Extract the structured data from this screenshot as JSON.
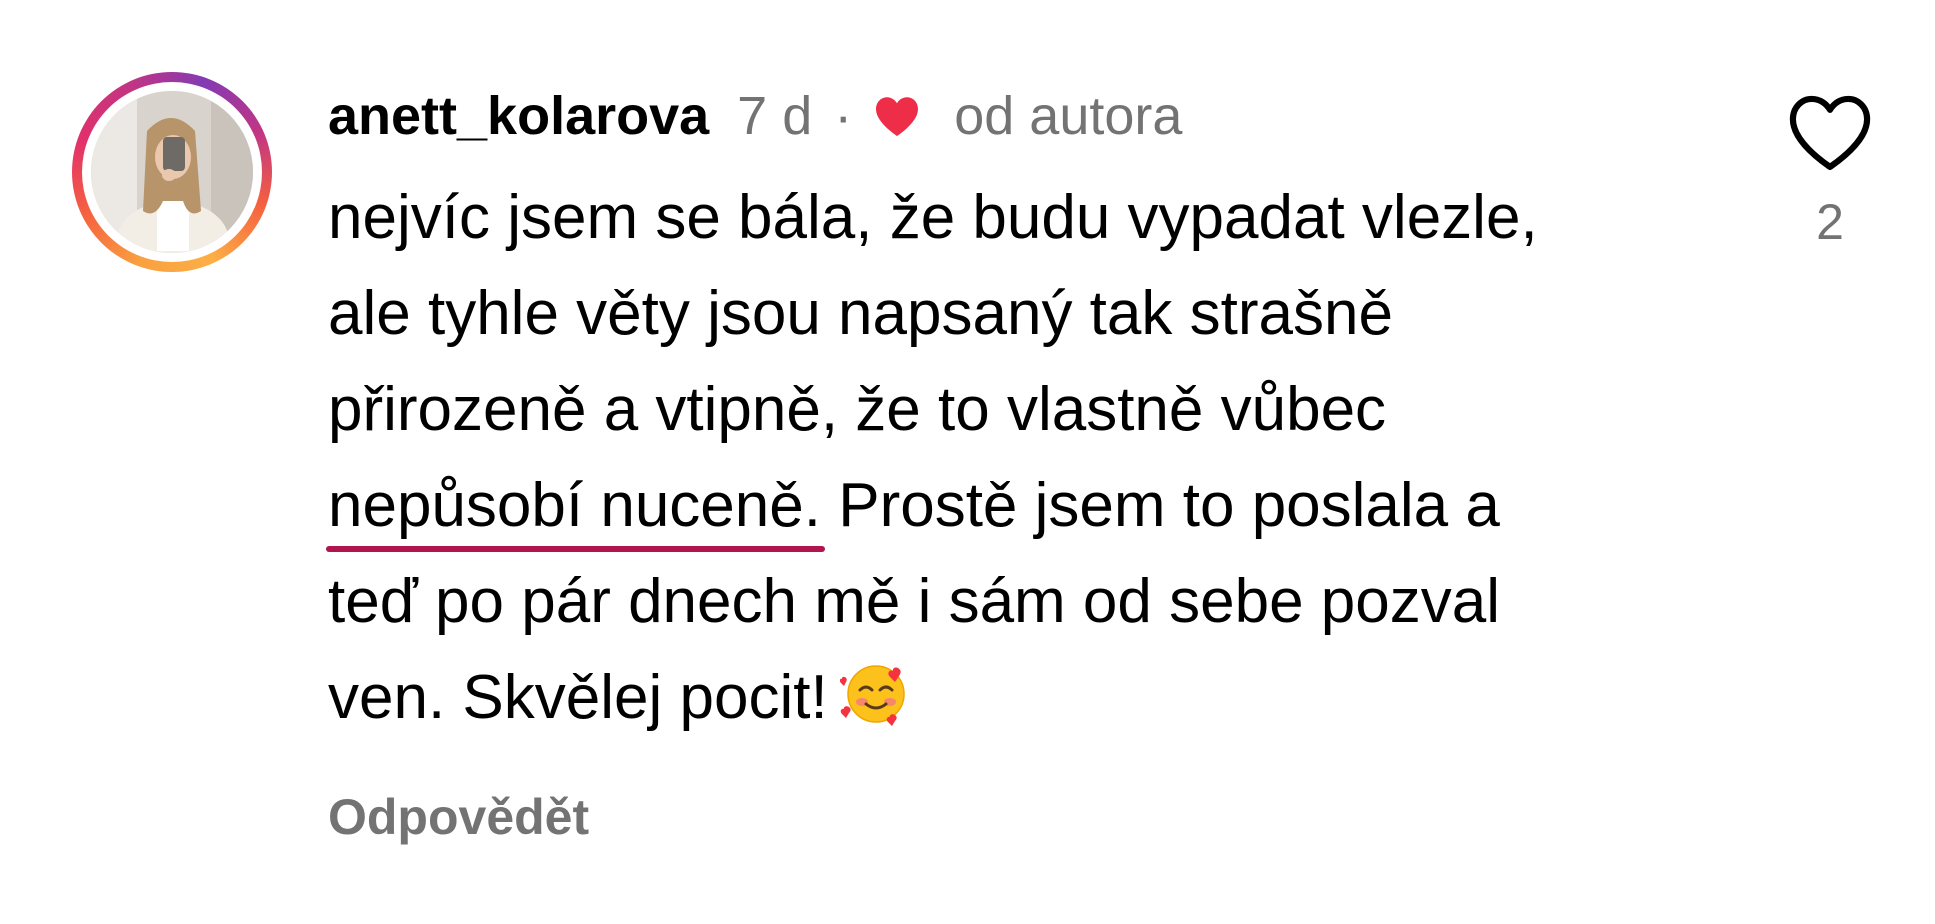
{
  "comment": {
    "username": "anett_kolarova",
    "time": "7 d",
    "separator": "·",
    "author_liked_icon": "red-heart-icon",
    "author_liked_label": "od autora",
    "text_lines": [
      "nejvíc jsem se bála, že budu vypadat vlezle,",
      "ale tyhle věty jsou napsaný tak strašně",
      "přirozeně a vtipně, že to vlastně vůbec",
      "Prostě jsem to poslala a",
      "teď po pár dnech mě i sám od sebe pozval",
      "ven. Skvělej pocit!"
    ],
    "underlined_text": "nepůsobí nuceně.",
    "emoji_icon": "smiling-face-with-hearts-icon",
    "reply_label": "Odpovědět",
    "like_icon": "heart-outline-icon",
    "like_count": "2"
  },
  "colors": {
    "author_heart": "#ee2e48",
    "muted_text": "#737373",
    "underline": "#b0154f",
    "story_ring_start": "#f9a03f",
    "story_ring_end": "#833ab4"
  }
}
